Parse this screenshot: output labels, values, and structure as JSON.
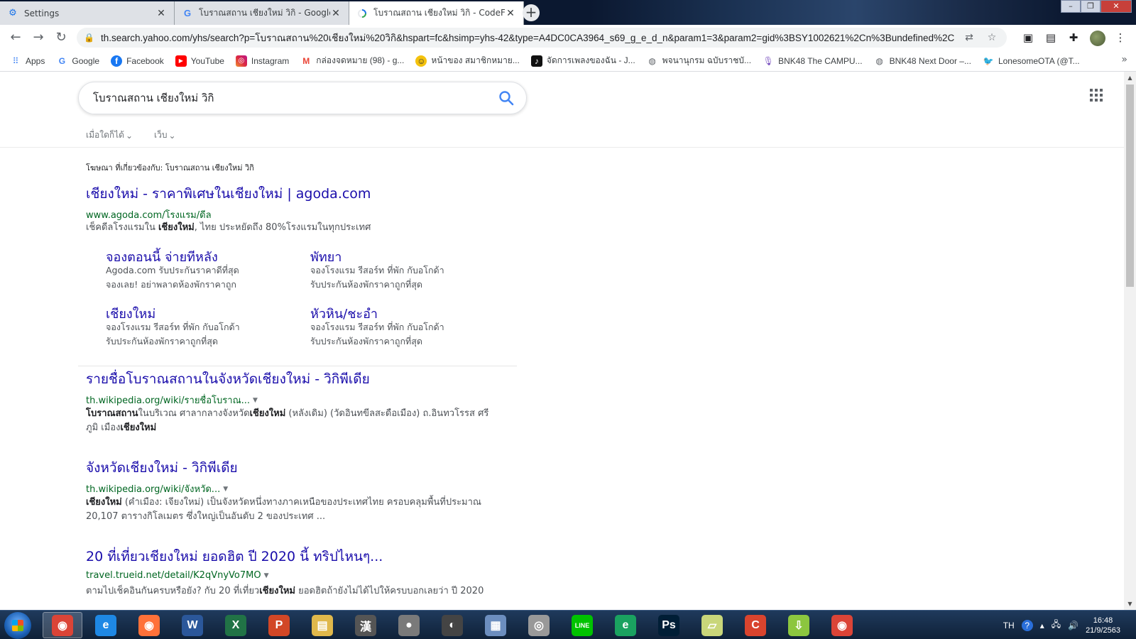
{
  "tabs": [
    {
      "label": "Settings",
      "icon": "gear-icon",
      "active": false
    },
    {
      "label": "โบราณสถาน เชียงใหม่ วิกิ - Google",
      "icon": "google-icon",
      "active": false
    },
    {
      "label": "โบราณสถาน เชียงใหม่ วิกิ - CodeFue",
      "icon": "loading-icon",
      "active": true
    }
  ],
  "toolbar": {
    "url": "th.search.yahoo.com/yhs/search?p=โบราณสถาน%20เชียงใหม่%20วิกิ&hspart=fc&hsimp=yhs-42&type=A4DC0CA3964_s69_g_e_d_n&param1=3&param2=gid%3BSY1002621%2Cn%3Bundefined%2C..."
  },
  "bookmarks": [
    {
      "label": "Apps",
      "icon": "apps-grid-icon",
      "color": "#4285f4"
    },
    {
      "label": "Google",
      "icon": "google-icon",
      "color": "#ffffff"
    },
    {
      "label": "Facebook",
      "icon": "facebook-icon",
      "color": "#1877f2"
    },
    {
      "label": "YouTube",
      "icon": "youtube-icon",
      "color": "#ff0000"
    },
    {
      "label": "Instagram",
      "icon": "instagram-icon",
      "color": "#c13584"
    },
    {
      "label": "กล่องจดหมาย (98) - g...",
      "icon": "gmail-icon",
      "color": "#ea4335"
    },
    {
      "label": "หน้าของ สมาชิกหมาย...",
      "icon": "smiley-icon",
      "color": "#f4c20d"
    },
    {
      "label": "จัดการเพลงของฉัน - J...",
      "icon": "music-icon",
      "color": "#111111"
    },
    {
      "label": "พจนานุกรม ฉบับราชบั...",
      "icon": "globe-icon",
      "color": "#5f6368"
    },
    {
      "label": "BNK48 The CAMPU...",
      "icon": "podcast-icon",
      "color": "#7e57c2"
    },
    {
      "label": "BNK48 Next Door –...",
      "icon": "globe-icon",
      "color": "#5f6368"
    },
    {
      "label": "LonesomeOTA (@T...",
      "icon": "twitter-icon",
      "color": "#1da1f2"
    }
  ],
  "search": {
    "query": "โบราณสถาน เชียงใหม่ วิกิ",
    "filters": [
      "เมื่อใดก็ได้",
      "เว็บ"
    ]
  },
  "ad": {
    "label": "โฆษณา ที่เกี่ยวข้องกับ: โบราณสถาน เชียงใหม่ วิกิ",
    "title": "เชียงใหม่ - ราคาพิเศษในเชียงใหม่ | agoda.com",
    "url": "www.agoda.com/โรงแรม/ดีล",
    "snippet_pre": "เช็คดีลโรงแรมใน ",
    "snippet_bold": "เชียงใหม่",
    "snippet_post": ", ไทย ประหยัดถึง 80%โรงแรมในทุกประเทศ",
    "sitelinks": [
      {
        "title": "จองตอนนี้ จ่ายทีหลัง",
        "line1": "Agoda.com รับประกันราคาดีที่สุด",
        "line2": "จองเลย! อย่าพลาดห้องพักราคาถูก"
      },
      {
        "title": "พัทยา",
        "line1": "จองโรงแรม รีสอร์ท ที่พัก กับอโกด้า",
        "line2": "รับประกันห้องพักราคาถูกที่สุด"
      },
      {
        "title": "เชียงใหม่",
        "line1": "จองโรงแรม รีสอร์ท ที่พัก กับอโกด้า",
        "line2": "รับประกันห้องพักราคาถูกที่สุด"
      },
      {
        "title": "หัวหิน/ชะอำ",
        "line1": "จองโรงแรม รีสอร์ท ที่พัก กับอโกด้า",
        "line2": "รับประกันห้องพักราคาถูกที่สุด"
      }
    ]
  },
  "results": [
    {
      "title": "รายชื่อโบราณสถานในจังหวัดเชียงใหม่ - วิกิพีเดีย",
      "url": "th.wikipedia.org/wiki/รายชื่อโบราณ...",
      "s1_bold": "โบราณสถาน",
      "s1": "ในบริเวณ ศาลากลางจังหวัด",
      "s2_bold": "เชียงใหม่",
      "s2": " (หลังเดิม) (วัดอินทขีลสะดือเมือง) ถ.อินทวโรรส ศรี",
      "s3": "ภูมิ เมือง",
      "s3_bold": "เชียงใหม่"
    },
    {
      "title": "จังหวัดเชียงใหม่ - วิกิพีเดีย",
      "url": "th.wikipedia.org/wiki/จังหวัด...",
      "s1_bold": "เชียงใหม่",
      "s1": " (คำเมือง: เจียงใหม่) เป็นจังหวัดหนึ่งทางภาคเหนือของประเทศไทย ครอบคลุมพื้นที่ประมาณ",
      "s2": "20,107 ตารางกิโลเมตร ซึ่งใหญ่เป็นอันดับ 2 ของประเทศ ..."
    },
    {
      "title": "20 ที่เที่ยวเชียงใหม่ ยอดฮิต ปี 2020 นี้ ทริปไหนๆ...",
      "url": "travel.trueid.net/detail/K2qVnyVo7MO",
      "s1": "ตามไปเช็คอินกันครบหรือยัง? กับ 20 ที่เที่ยว",
      "s1_bold": "เชียงใหม่",
      "s2": " ยอดฮิตถ้ายังไม่ได้ไปให้ครบบอกเลยว่า ปี 2020"
    }
  ],
  "taskbar": {
    "apps": [
      {
        "name": "chrome",
        "glyph": "◉",
        "color": "#db4437"
      },
      {
        "name": "internet-explorer",
        "glyph": "e",
        "color": "#1e88e5"
      },
      {
        "name": "firefox",
        "glyph": "◉",
        "color": "#ff7139"
      },
      {
        "name": "word",
        "glyph": "W",
        "color": "#2b579a"
      },
      {
        "name": "excel",
        "glyph": "X",
        "color": "#217346"
      },
      {
        "name": "powerpoint",
        "glyph": "P",
        "color": "#d24726"
      },
      {
        "name": "file-explorer",
        "glyph": "▤",
        "color": "#e0b84b"
      },
      {
        "name": "dictionary",
        "glyph": "漢",
        "color": "#555555"
      },
      {
        "name": "bandicam",
        "glyph": "●",
        "color": "#7a7a7a"
      },
      {
        "name": "cd-burner",
        "glyph": "◐",
        "color": "#444444"
      },
      {
        "name": "calculator",
        "glyph": "▦",
        "color": "#6c8ebf"
      },
      {
        "name": "camera",
        "glyph": "◎",
        "color": "#999999"
      },
      {
        "name": "line",
        "glyph": "LINE",
        "color": "#00c300"
      },
      {
        "name": "edge-like",
        "glyph": "e",
        "color": "#1aa260"
      },
      {
        "name": "photoshop",
        "glyph": "Ps",
        "color": "#001e36"
      },
      {
        "name": "notes",
        "glyph": "▱",
        "color": "#c9d67a"
      },
      {
        "name": "ccleaner",
        "glyph": "C",
        "color": "#d9442e"
      },
      {
        "name": "download-manager",
        "glyph": "⇩",
        "color": "#8cc63f"
      },
      {
        "name": "chrome-2",
        "glyph": "◉",
        "color": "#db4437"
      }
    ],
    "lang": "TH",
    "time": "16:48",
    "date": "21/9/2563"
  }
}
